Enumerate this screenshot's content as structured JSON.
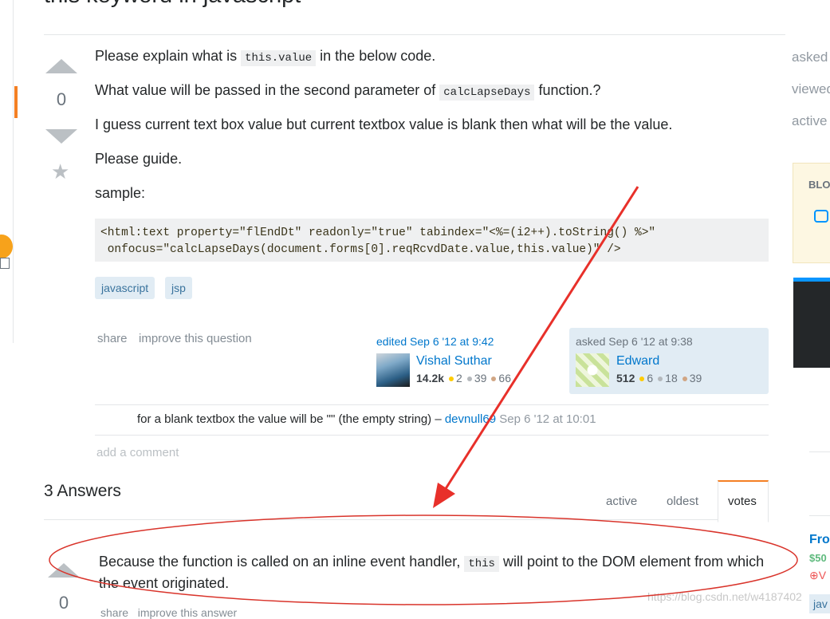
{
  "question": {
    "title": "this keyword in javascript",
    "vote_count": "0",
    "body": {
      "p1_before": "Please explain what is",
      "p1_code": "this.value",
      "p1_after": "in the below code.",
      "p2_before": "What value will be passed in the second parameter of",
      "p2_code": "calcLapseDays",
      "p2_after": "function.?",
      "p3": "I guess current text box value but current textbox value is blank then what will be the value.",
      "p4": "Please guide.",
      "p5": "sample:",
      "code_line1": "<html:text property=\"flEndDt\" readonly=\"true\" tabindex=\"<%=(i2++).toString() %>\"",
      "code_line2": " onfocus=\"calcLapseDays(document.forms[0].reqRcvdDate.value,this.value)\" />"
    },
    "tags": [
      "javascript",
      "jsp"
    ],
    "share_label": "share",
    "improve_label": "improve this question",
    "edited": {
      "label": "edited Sep 6 '12 at 9:42",
      "user": "Vishal Suthar",
      "rep": "14.2k",
      "gold": "2",
      "silver": "39",
      "bronze": "66"
    },
    "asked": {
      "label": "asked Sep 6 '12 at 9:38",
      "user": "Edward",
      "rep": "512",
      "gold": "6",
      "silver": "18",
      "bronze": "39"
    },
    "comment": {
      "text": "for a blank textbox the value will be \"\" (the empty string) –",
      "user": "devnull69",
      "time": "Sep 6 '12 at 10:01"
    },
    "add_comment": "add a comment"
  },
  "answers": {
    "heading": "3 Answers",
    "tabs": [
      "active",
      "oldest",
      "votes"
    ],
    "active_tab": "votes",
    "first": {
      "vote_count": "0",
      "text_before": "Because the function is called on an inline event handler,",
      "text_code": "this",
      "text_after": "will point to the DOM element from which the event originated.",
      "share_label": "share",
      "improve_label": "improve this answer"
    }
  },
  "sidebar": {
    "asked_label": "asked",
    "viewed_label": "viewed",
    "active_label": "active",
    "blog_label": "BLO",
    "job_title": "Fro",
    "job_salary": "$50",
    "job_location": "V",
    "job_tag": "jav"
  },
  "watermark": "https://blog.csdn.net/w4187402",
  "annotation": {
    "arrow_color": "#e8302a",
    "ellipse_color": "#d9342b"
  }
}
